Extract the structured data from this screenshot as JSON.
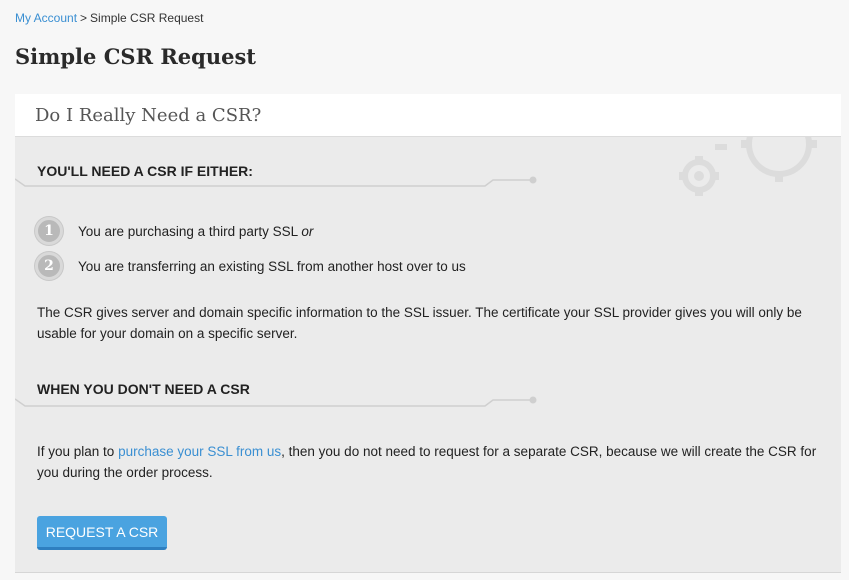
{
  "breadcrumb": {
    "parent": "My Account",
    "separator": ">",
    "current": "Simple CSR Request"
  },
  "page_title": "Simple CSR Request",
  "card": {
    "title": "Do I Really Need a CSR?",
    "section1": {
      "heading": "YOU'LL NEED A CSR IF EITHER:",
      "steps": [
        {
          "number": "1",
          "text": "You are purchasing a third party SSL ",
          "emphasis": "or"
        },
        {
          "number": "2",
          "text": "You are transferring an existing SSL from another host over to us",
          "emphasis": ""
        }
      ],
      "paragraph": "The CSR gives server and domain specific information to the SSL issuer. The certificate your SSL provider gives you will only be usable for your domain on a specific server."
    },
    "section2": {
      "heading": "WHEN YOU DON'T NEED A CSR",
      "para_before": "If you plan to ",
      "para_link": "purchase your SSL from us",
      "para_after": ", then you do not need to request for a separate CSR, because we will create the CSR for you during the order process."
    },
    "button_label": "REQUEST A CSR"
  },
  "colors": {
    "link": "#3a8fd2",
    "button": "#4aa3e0",
    "card_bg": "#ebebeb"
  },
  "icons": {
    "step_marker": "numbered-circle",
    "decoration": "gears-icon"
  }
}
